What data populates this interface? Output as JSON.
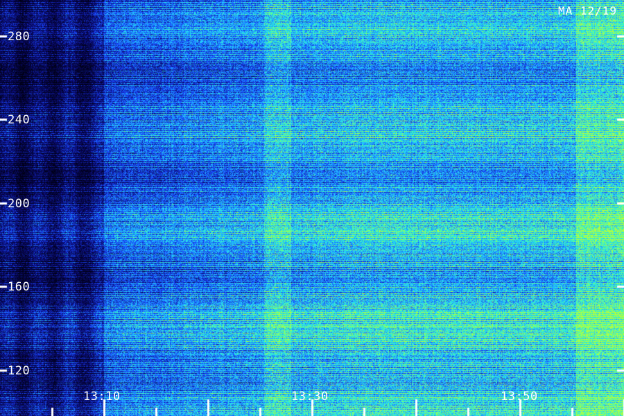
{
  "corner_label": "MA 12/19",
  "y_ticks": [
    "280",
    "240",
    "200",
    "160",
    "120"
  ],
  "x_ticks": [
    "13:10",
    "13:30",
    "13:50"
  ],
  "colors": {
    "background": "#000010",
    "low": "#0a0a70",
    "mid": "#1a5cff",
    "high": "#21d4ff",
    "peak": "#7dff3a",
    "tick": "#ffffff"
  }
}
